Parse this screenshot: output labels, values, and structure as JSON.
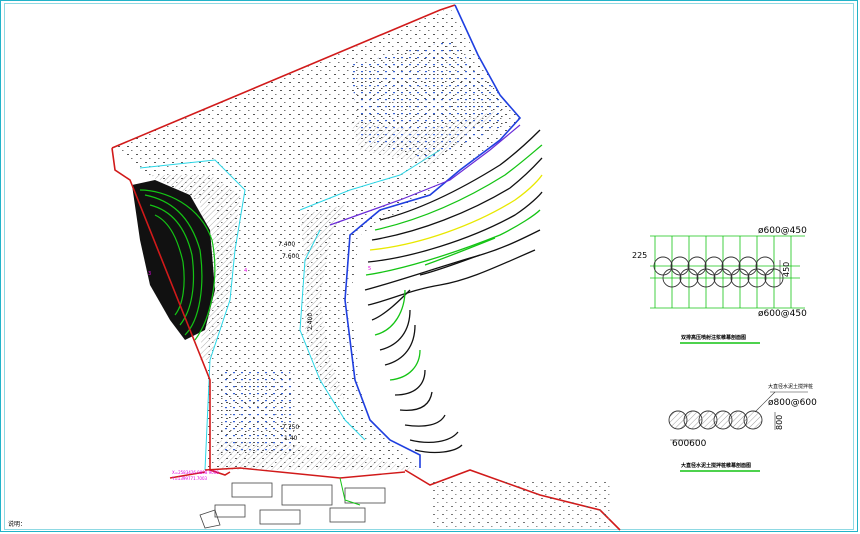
{
  "drawing": {
    "elevation_labels": {
      "upper_a": "7.400",
      "upper_b": "7.600",
      "vertical": "2.400",
      "lower_a": "7.750",
      "lower_b": "1.40"
    },
    "magenta_notes": {
      "line1": "X=2583426.9808 9008",
      "line2": "Y=1399771.7003"
    },
    "markers": {
      "left": "3",
      "mid": "4",
      "right": "5"
    },
    "bottom_note": "说明："
  },
  "details": {
    "jet_grout": {
      "spec_top": "ø600@450",
      "spec_bottom": "ø600@450",
      "dim_left": "225",
      "dim_right": "450",
      "title": "双排高压喷射注浆帷幕剖面图"
    },
    "pile": {
      "callout": "大直径水泥土搅拌桩",
      "spec": "ø800@600",
      "dim_bottom": "600600",
      "dim_right": "800",
      "title": "大直径水泥土搅拌桩帷幕剖面图"
    }
  },
  "colors": {
    "frame": "#22b3c9",
    "boundary_red": "#d11a1a",
    "boundary_blue": "#1f3fe0",
    "contour_green": "#14c414",
    "contour_yellow": "#e8e800",
    "cyan": "#2ad6e6",
    "magenta": "#e000e0",
    "purple": "#6a2bd8"
  }
}
